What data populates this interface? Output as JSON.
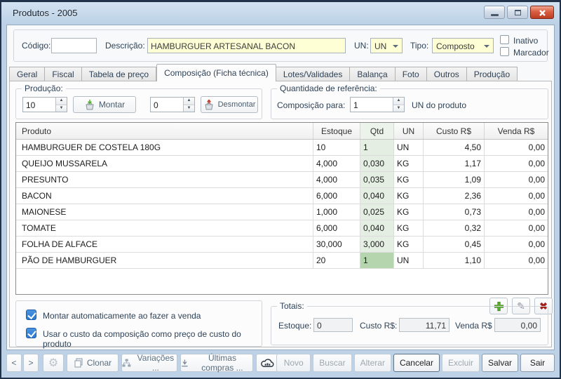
{
  "window": {
    "title": "Produtos - 2005"
  },
  "colors": {
    "frame_blue": "#bdd2e6",
    "accent_yellow": "#ffffd6",
    "qtd_cell_green": "#e4eee2",
    "qtd_selected_green": "#b5d5af",
    "checkbox_blue": "#2d7ad3",
    "add_green": "#55b42e",
    "delete_red": "#a3201a"
  },
  "header": {
    "codigo_label": "Código:",
    "codigo_value": "",
    "descricao_label": "Descrição:",
    "descricao_value": "HAMBURGUER ARTESANAL BACON",
    "un_label": "UN:",
    "un_value": "UN",
    "tipo_label": "Tipo:",
    "tipo_value": "Composto",
    "inativo_label": "Inativo",
    "marcador_label": "Marcador"
  },
  "tabs": {
    "active_index": 3,
    "items": [
      "Geral",
      "Fiscal",
      "Tabela de preço",
      "Composição (Ficha técnica)",
      "Lotes/Validades",
      "Balança",
      "Foto",
      "Outros",
      "Produção"
    ]
  },
  "production": {
    "group_label": "Produção:",
    "montar_qty": "10",
    "montar_label": "Montar",
    "desmontar_qty": "0",
    "desmontar_label": "Desmontar"
  },
  "reference": {
    "group_label": "Quantidade de referência:",
    "composicao_label": "Composição para:",
    "value": "1",
    "suffix": "UN do produto"
  },
  "table": {
    "headers": [
      "Produto",
      "Estoque",
      "Qtd",
      "UN",
      "Custo R$",
      "Venda R$"
    ],
    "rows": [
      {
        "produto": "HAMBURGUER DE COSTELA 180G",
        "estoque": "10",
        "qtd": "1",
        "un": "UN",
        "custo": "4,50",
        "venda": "0,00",
        "qtd_selected": false
      },
      {
        "produto": "QUEIJO MUSSARELA",
        "estoque": "4,000",
        "qtd": "0,030",
        "un": "KG",
        "custo": "1,17",
        "venda": "0,00",
        "qtd_selected": false
      },
      {
        "produto": "PRESUNTO",
        "estoque": "4,000",
        "qtd": "0,035",
        "un": "KG",
        "custo": "1,09",
        "venda": "0,00",
        "qtd_selected": false
      },
      {
        "produto": "BACON",
        "estoque": "6,000",
        "qtd": "0,040",
        "un": "KG",
        "custo": "2,36",
        "venda": "0,00",
        "qtd_selected": false
      },
      {
        "produto": "MAIONESE",
        "estoque": "1,000",
        "qtd": "0,025",
        "un": "KG",
        "custo": "0,73",
        "venda": "0,00",
        "qtd_selected": false
      },
      {
        "produto": "TOMATE",
        "estoque": "6,000",
        "qtd": "0,040",
        "un": "KG",
        "custo": "0,32",
        "venda": "0,00",
        "qtd_selected": false
      },
      {
        "produto": "FOLHA DE ALFACE",
        "estoque": "30,000",
        "qtd": "3,000",
        "un": "KG",
        "custo": "0,45",
        "venda": "0,00",
        "qtd_selected": false
      },
      {
        "produto": "PÃO DE HAMBURGUER",
        "estoque": "20",
        "qtd": "1",
        "un": "UN",
        "custo": "1,10",
        "venda": "0,00",
        "qtd_selected": true
      }
    ]
  },
  "options": {
    "montar_auto_label": "Montar automaticamente ao fazer a venda",
    "usar_custo_label": "Usar o custo da composição como preço de custo do produto"
  },
  "totals": {
    "group_label": "Totais:",
    "estoque_label": "Estoque:",
    "estoque_value": "0",
    "custo_label": "Custo R$:",
    "custo_value": "11,71",
    "venda_label": "Venda R$",
    "venda_value": "0,00"
  },
  "toolbar": {
    "prev_label": "<",
    "next_label": ">",
    "clonar_label": "Clonar",
    "variacoes_label": "Variações ...",
    "ultimas_label": "Últimas compras ..."
  },
  "actions": {
    "items": [
      {
        "label": "Novo",
        "enabled": false
      },
      {
        "label": "Buscar",
        "enabled": false
      },
      {
        "label": "Alterar",
        "enabled": false
      },
      {
        "label": "Cancelar",
        "enabled": true,
        "default": true
      },
      {
        "label": "Excluir",
        "enabled": false
      },
      {
        "label": "Salvar",
        "enabled": true
      },
      {
        "label": "Sair",
        "enabled": true
      }
    ]
  }
}
